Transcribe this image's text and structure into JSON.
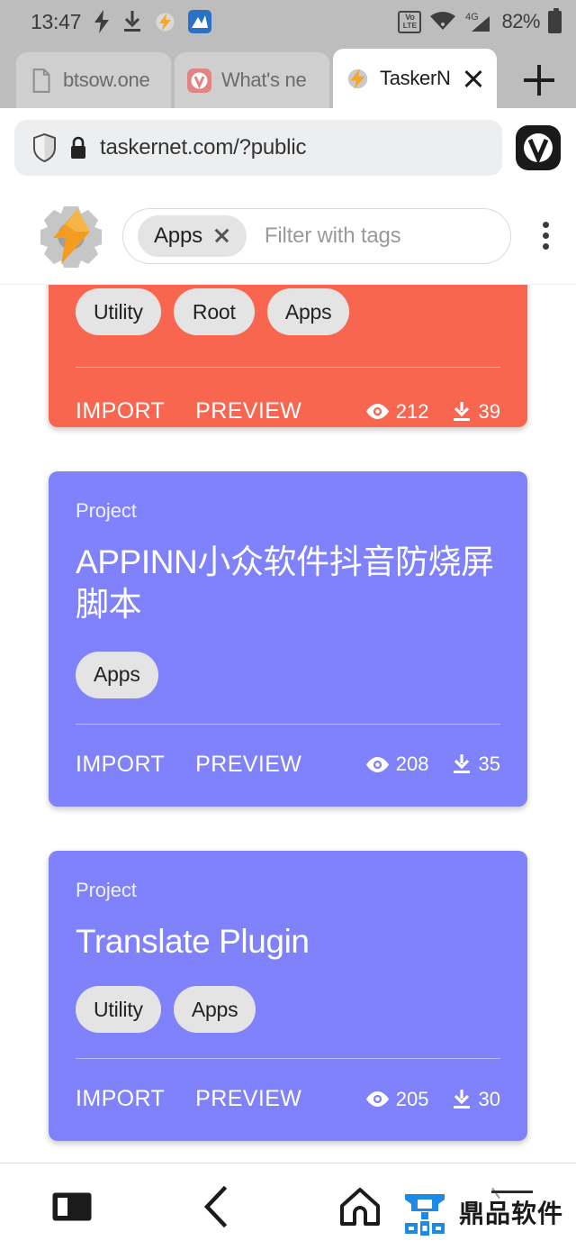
{
  "status_bar": {
    "time": "13:47",
    "icons": [
      "flash-icon",
      "download-icon",
      "tasker-notification-icon",
      "blue-app-icon"
    ],
    "volte_top": "Vo",
    "volte_bottom": "LTE",
    "network": "4G",
    "battery_percent": "82%"
  },
  "browser": {
    "tabs": [
      {
        "label": "btsow.one",
        "favicon": "page-icon",
        "active": false
      },
      {
        "label": "What's ne",
        "favicon": "vivaldi-icon",
        "active": false
      },
      {
        "label": "TaskerN",
        "favicon": "tasker-icon",
        "active": true
      }
    ],
    "new_tab_label": "+",
    "url": "taskernet.com/?public",
    "security": "lock-icon",
    "shield": "shield-icon",
    "vivaldi_button": "vivaldi-menu-icon"
  },
  "site_header": {
    "logo": "tasker-logo-icon",
    "active_tag": "Apps",
    "filter_placeholder": "Filter with tags",
    "overflow_menu": "kebab-menu-icon"
  },
  "colors": {
    "card_orange": "#f9664f",
    "card_purple": "#7f82fa",
    "tag_bg": "#e4e4e4",
    "watermark_blue": "#1e8ae8"
  },
  "cards": [
    {
      "kind": "",
      "title": "",
      "color": "#f9664f",
      "tags": [
        "Utility",
        "Root",
        "Apps"
      ],
      "import_label": "IMPORT",
      "preview_label": "PREVIEW",
      "views": "212",
      "downloads": "39",
      "clipped_top": true
    },
    {
      "kind": "Project",
      "title": "APPINN小众软件抖音防烧屏脚本",
      "color": "#7f82fa",
      "tags": [
        "Apps"
      ],
      "import_label": "IMPORT",
      "preview_label": "PREVIEW",
      "views": "208",
      "downloads": "35",
      "clipped_top": false
    },
    {
      "kind": "Project",
      "title": "Translate Plugin",
      "color": "#7f82fa",
      "tags": [
        "Utility",
        "Apps"
      ],
      "import_label": "IMPORT",
      "preview_label": "PREVIEW",
      "views": "205",
      "downloads": "30",
      "clipped_top": false
    }
  ],
  "bottom_nav": {
    "items": [
      "recents-icon",
      "back-icon",
      "home-icon"
    ],
    "watermark_text": "鼎品软件",
    "watermark_logo": "dingpin-logo-icon"
  }
}
